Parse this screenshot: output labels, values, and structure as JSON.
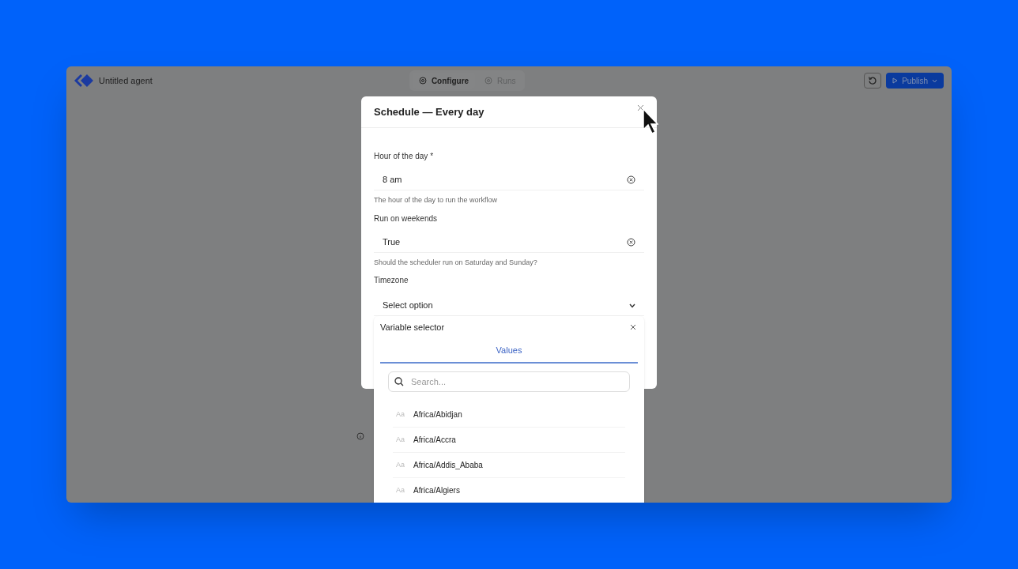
{
  "header": {
    "title": "Untitled agent",
    "tabs": [
      {
        "label": "Configure",
        "selected": true
      },
      {
        "label": "Runs",
        "selected": false
      }
    ],
    "publish": "Publish"
  },
  "modal": {
    "title": "Schedule — Every day",
    "fields": [
      {
        "kind": "input",
        "label": "Hour of the day *",
        "value": "8 am",
        "help": "The hour of the day to run the workflow"
      },
      {
        "kind": "input",
        "label": "Run on weekends",
        "value": "True",
        "help": "Should the scheduler run on Saturday and Sunday?"
      },
      {
        "kind": "select",
        "label": "Timezone",
        "placeholder": "Select option"
      }
    ]
  },
  "selector": {
    "title": "Variable selector",
    "tabs": [
      {
        "label": "Values",
        "selected": true
      }
    ],
    "search": {
      "placeholder": "Search..."
    },
    "options": [
      {
        "type": "Aa",
        "label": "Africa/Abidjan"
      },
      {
        "type": "Aa",
        "label": "Africa/Accra"
      },
      {
        "type": "Aa",
        "label": "Africa/Addis_Ababa"
      },
      {
        "type": "Aa",
        "label": "Africa/Algiers"
      }
    ]
  }
}
